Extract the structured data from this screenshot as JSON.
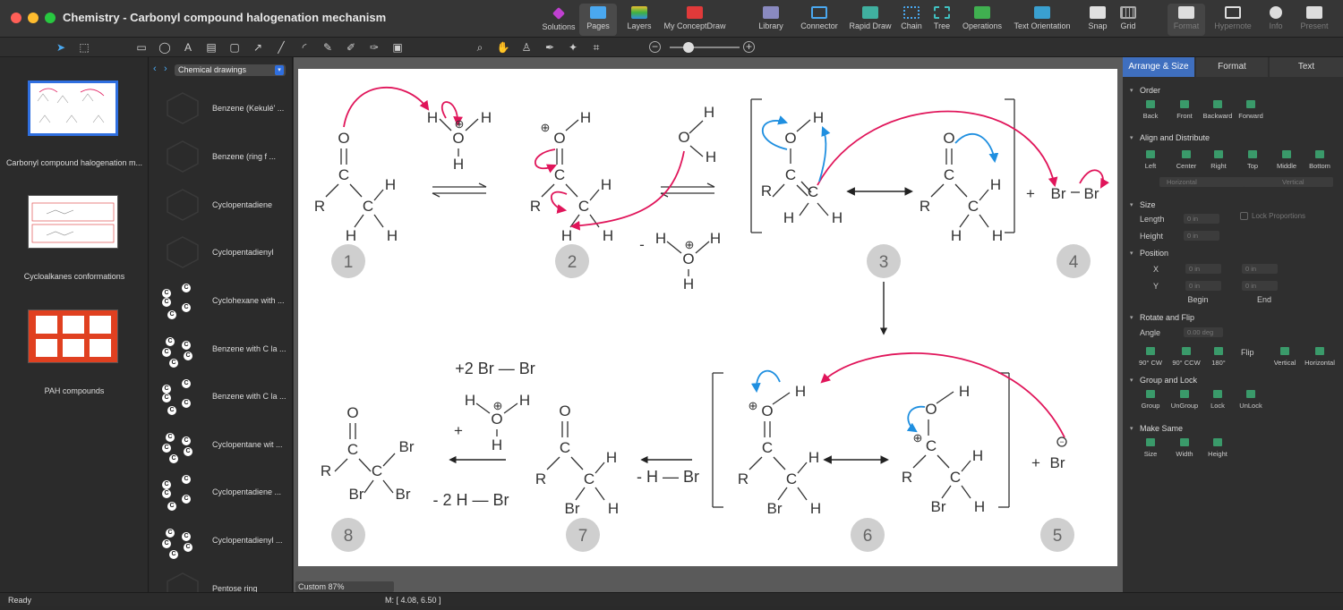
{
  "window": {
    "title": "Chemistry - Carbonyl compound halogenation mechanism"
  },
  "toolbar": {
    "solutions": "Solutions",
    "pages": "Pages",
    "layers": "Layers",
    "myconceptdraw": "My ConceptDraw",
    "library": "Library",
    "connector": "Connector",
    "rapid_draw": "Rapid Draw",
    "chain": "Chain",
    "tree": "Tree",
    "operations": "Operations",
    "text_orientation": "Text Orientation",
    "snap": "Snap",
    "grid": "Grid",
    "format": "Format",
    "hypernote": "Hypernote",
    "info": "Info",
    "present": "Present"
  },
  "pages_panel": {
    "items": [
      {
        "label": "Carbonyl compound halogenation m..."
      },
      {
        "label": "Cycloalkanes conformations"
      },
      {
        "label": "PAH compounds"
      }
    ]
  },
  "library_panel": {
    "selected": "Chemical drawings",
    "items": [
      {
        "label": "Benzene (Kekulé' ..."
      },
      {
        "label": "Benzene (ring f ..."
      },
      {
        "label": "Cyclopentadiene"
      },
      {
        "label": "Cyclopentadienyl"
      },
      {
        "label": "Cyclohexane with ..."
      },
      {
        "label": "Benzene with C la ..."
      },
      {
        "label": "Benzene with C la ..."
      },
      {
        "label": "Cyclopentane wit ..."
      },
      {
        "label": "Cyclopentadiene ..."
      },
      {
        "label": "Cyclopentadienyl ..."
      },
      {
        "label": "Pentose ring"
      }
    ],
    "atom": "C"
  },
  "zoom": {
    "label": "Custom 87%"
  },
  "status": {
    "ready": "Ready",
    "coords": "M: [ 4.08, 6.50 ]"
  },
  "diagram": {
    "atoms": {
      "O": "O",
      "C": "C",
      "H": "H",
      "R": "R",
      "Br": "Br",
      "plus": "+",
      "minus": "-",
      "minus_c": "−",
      "bond_dash": "—",
      "charge": "⊕"
    },
    "steps": [
      "1",
      "2",
      "3",
      "4",
      "5",
      "6",
      "7",
      "8"
    ],
    "reagent_hbr": "- H — Br",
    "product_br2": "+2 Br — Br",
    "minus_2hbr": "- 2 H — Br"
  },
  "right_panel": {
    "tabs": [
      "Arrange & Size",
      "Format",
      "Text"
    ],
    "order": {
      "title": "Order",
      "items": [
        "Back",
        "Front",
        "Backward",
        "Forward"
      ]
    },
    "align": {
      "title": "Align and Distribute",
      "items": [
        "Left",
        "Center",
        "Right",
        "Top",
        "Middle",
        "Bottom"
      ],
      "horizontal": "Horizontal",
      "vertical": "Vertical"
    },
    "size": {
      "title": "Size",
      "length": "Length",
      "height": "Height",
      "length_val": "0 in",
      "height_val": "0 in",
      "lock": "Lock Proportions"
    },
    "position": {
      "title": "Position",
      "x": "X",
      "y": "Y",
      "x_begin": "0 in",
      "x_end": "0 in",
      "y_begin": "0 in",
      "y_end": "0 in",
      "begin": "Begin",
      "end": "End"
    },
    "rotate": {
      "title": "Rotate and Flip",
      "angle": "Angle",
      "angle_val": "0.00 deg",
      "items": [
        "90° CW",
        "90° CCW",
        "180°"
      ],
      "flip": "Flip",
      "flip_items": [
        "Vertical",
        "Horizontal"
      ]
    },
    "group": {
      "title": "Group and Lock",
      "items": [
        "Group",
        "UnGroup",
        "Lock",
        "UnLock"
      ]
    },
    "same": {
      "title": "Make Same",
      "items": [
        "Size",
        "Width",
        "Height"
      ]
    }
  },
  "colors": {
    "accent": "#2f6fe0",
    "red_arrow": "#e0155a",
    "blue_arrow": "#1f8fe0",
    "step_circle": "#cfcfcf"
  }
}
